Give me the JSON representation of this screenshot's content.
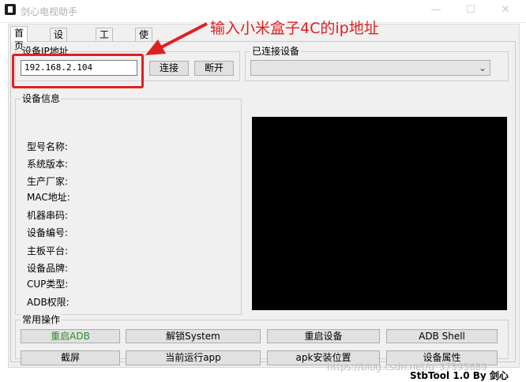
{
  "window": {
    "title": "剑心电视助手",
    "controls": {
      "minimize": "—",
      "maximize": "☐",
      "close": "✕"
    }
  },
  "tabs": [
    "首页",
    "设备管理",
    "工具箱",
    "使用说明"
  ],
  "ip_group": {
    "label": "设备IP地址",
    "ip_value": "192.168.2.104",
    "connect_label": "连接",
    "disconnect_label": "断开"
  },
  "connected_group": {
    "label": "已连接设备",
    "selected": ""
  },
  "device_info": {
    "label": "设备信息",
    "fields": [
      "型号名称:",
      "系统版本:",
      "生产厂家:",
      "MAC地址:",
      "机器串码:",
      "设备编号:",
      "主板平台:",
      "设备品牌:",
      "CUP类型:",
      "ADB权限:"
    ]
  },
  "common_ops": {
    "label": "常用操作",
    "row1": [
      "重启ADB",
      "解锁System",
      "重启设备",
      "ADB Shell"
    ],
    "row2": [
      "截屏",
      "当前运行app",
      "apk安装位置",
      "设备属性"
    ],
    "first_button_color": "#2e8b2e"
  },
  "annotation": {
    "text": "输入小米盒子4C的ip地址",
    "color": "#e02020"
  },
  "status_bar": "StbTool 1.0  By 剑心",
  "watermark": "https://blog.csdn.net/u_37595689"
}
